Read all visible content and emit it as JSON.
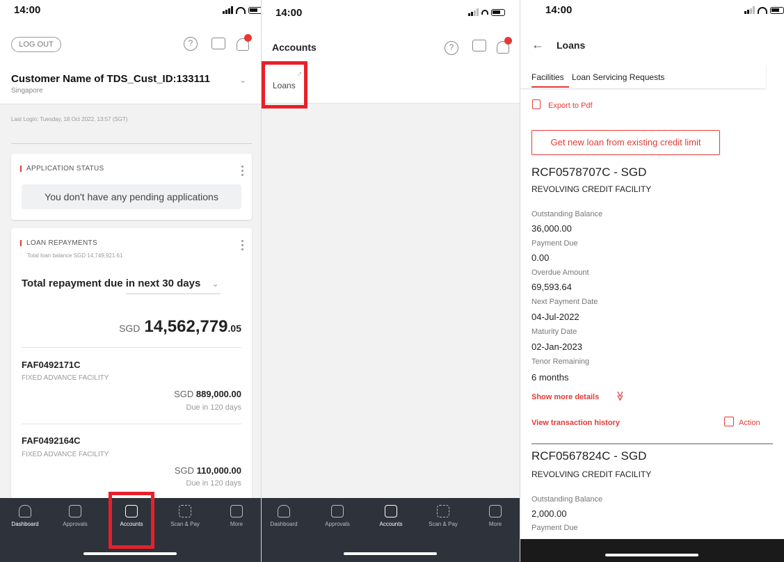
{
  "screen1": {
    "time": "14:00",
    "logout_label": "LOG OUT",
    "help_icon": "?",
    "customer_name": "Customer Name of TDS_Cust_ID:133111",
    "customer_location": "Singapore",
    "last_login": "Last Login: Tuesday, 18 Oct 2022, 13:57 (SGT)",
    "application_status": {
      "title": "APPLICATION STATUS",
      "message": "You don't have any pending applications"
    },
    "loan_repayments": {
      "title": "LOAN REPAYMENTS",
      "total_balance": "Total loan balance SGD 14,749,921.61",
      "period_label": "Total repayment due in next 30 days",
      "currency": "SGD",
      "amount_whole": "14,562,779",
      "amount_decimal": ".05",
      "facilities": [
        {
          "id": "FAF0492171C",
          "type": "FIXED ADVANCE FACILITY",
          "currency": "SGD",
          "amount": "889,000.00",
          "due": "Due in 120 days"
        },
        {
          "id": "FAF0492164C",
          "type": "FIXED ADVANCE FACILITY",
          "currency": "SGD",
          "amount": "110,000.00",
          "due": "Due in 120 days"
        }
      ]
    }
  },
  "tabs": [
    "Dashboard",
    "Approvals",
    "Accounts",
    "Scan & Pay",
    "More"
  ],
  "active_tab": "Accounts",
  "screen2": {
    "time": "14:00",
    "title": "Accounts",
    "loans_link": "Loans",
    "arrow": "→"
  },
  "screen3": {
    "time": "14:00",
    "back_arrow": "←",
    "title": "Loans",
    "tab_facilities": "Facilities",
    "tab_requests": "Loan Servicing Requests",
    "export_label": "Export to Pdf",
    "new_loan_label": "Get new loan from existing credit limit",
    "account1": {
      "id": "RCF0578707C - SGD",
      "type": "REVOLVING CREDIT FACILITY",
      "fields": [
        {
          "label": "Outstanding Balance",
          "value": "36,000.00"
        },
        {
          "label": "Payment Due",
          "value": "0.00"
        },
        {
          "label": "Overdue Amount",
          "value": "69,593.64"
        },
        {
          "label": "Next Payment Date",
          "value": "04-Jul-2022"
        },
        {
          "label": "Maturity Date",
          "value": "02-Jan-2023"
        },
        {
          "label": "Tenor Remaining",
          "value": "6 months"
        }
      ]
    },
    "show_more": "Show more details",
    "show_more_chevron": "≫",
    "view_history": "View transaction history",
    "action_label": "Action",
    "account2": {
      "id": "RCF0567824C - SGD",
      "type": "REVOLVING CREDIT FACILITY",
      "fields": [
        {
          "label": "Outstanding Balance",
          "value": "2,000.00"
        },
        {
          "label": "Payment Due",
          "value": ""
        }
      ]
    }
  },
  "colors": {
    "accent": "#e53935",
    "highlight": "#e8202a",
    "tabbar": "#2e323a"
  }
}
